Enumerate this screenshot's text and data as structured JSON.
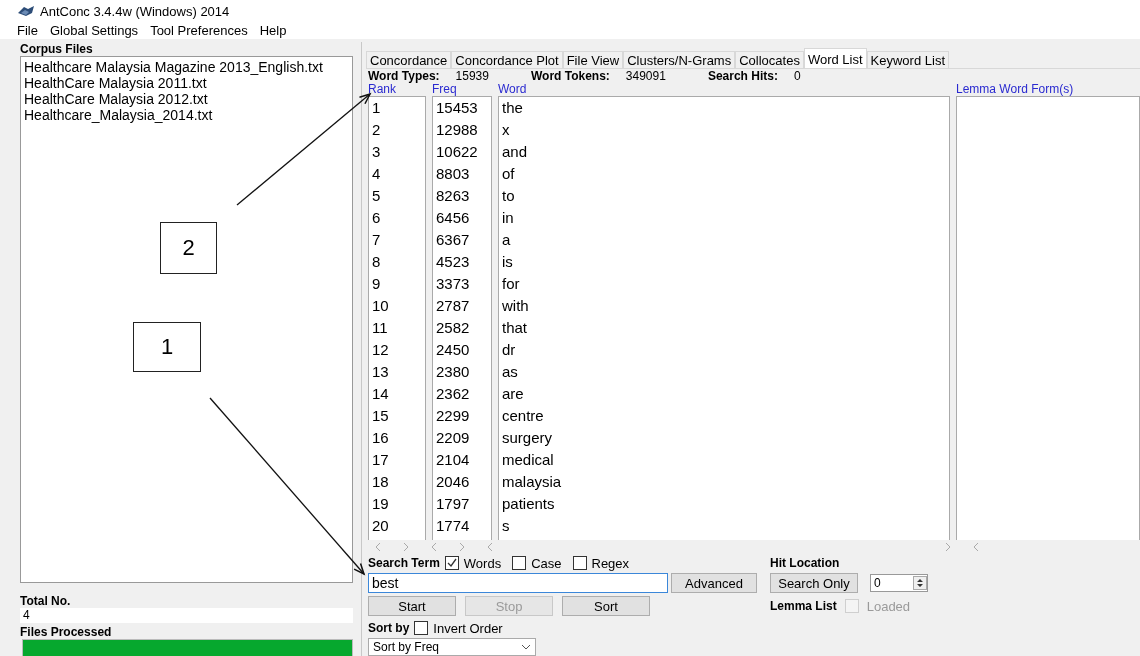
{
  "window": {
    "title": "AntConc 3.4.4w (Windows) 2014"
  },
  "menu": [
    "File",
    "Global Settings",
    "Tool Preferences",
    "Help"
  ],
  "corpus_files": {
    "label": "Corpus Files",
    "files": [
      "Healthcare Malaysia Magazine 2013_English.txt",
      "HealthCare Malaysia 2011.txt",
      "HealthCare Malaysia 2012.txt",
      "Healthcare_Malaysia_2014.txt"
    ]
  },
  "total": {
    "label": "Total No.",
    "value": "4"
  },
  "files_processed": {
    "label": "Files Processed",
    "level": 1
  },
  "tabs": [
    {
      "label": "Concordance",
      "selected": false
    },
    {
      "label": "Concordance Plot",
      "selected": false
    },
    {
      "label": "File View",
      "selected": false
    },
    {
      "label": "Clusters/N-Grams",
      "selected": false
    },
    {
      "label": "Collocates",
      "selected": false
    },
    {
      "label": "Word List",
      "selected": true
    },
    {
      "label": "Keyword List",
      "selected": false
    }
  ],
  "stats": [
    {
      "label": "Word Types:",
      "value": "15939"
    },
    {
      "label": "Word Tokens:",
      "value": "349091"
    },
    {
      "label": "Search Hits:",
      "value": "0"
    }
  ],
  "columns": [
    "Rank",
    "Freq",
    "Word"
  ],
  "rows": [
    {
      "rank": "1",
      "freq": "15453",
      "word": "the"
    },
    {
      "rank": "2",
      "freq": "12988",
      "word": "x"
    },
    {
      "rank": "3",
      "freq": "10622",
      "word": "and"
    },
    {
      "rank": "4",
      "freq": "8803",
      "word": "of"
    },
    {
      "rank": "5",
      "freq": "8263",
      "word": "to"
    },
    {
      "rank": "6",
      "freq": "6456",
      "word": "in"
    },
    {
      "rank": "7",
      "freq": "6367",
      "word": "a"
    },
    {
      "rank": "8",
      "freq": "4523",
      "word": "is"
    },
    {
      "rank": "9",
      "freq": "3373",
      "word": "for"
    },
    {
      "rank": "10",
      "freq": "2787",
      "word": "with"
    },
    {
      "rank": "11",
      "freq": "2582",
      "word": "that"
    },
    {
      "rank": "12",
      "freq": "2450",
      "word": "dr"
    },
    {
      "rank": "13",
      "freq": "2380",
      "word": "as"
    },
    {
      "rank": "14",
      "freq": "2362",
      "word": "are"
    },
    {
      "rank": "15",
      "freq": "2299",
      "word": "centre"
    },
    {
      "rank": "16",
      "freq": "2209",
      "word": "surgery"
    },
    {
      "rank": "17",
      "freq": "2104",
      "word": "medical"
    },
    {
      "rank": "18",
      "freq": "2046",
      "word": "malaysia"
    },
    {
      "rank": "19",
      "freq": "1797",
      "word": "patients"
    },
    {
      "rank": "20",
      "freq": "1774",
      "word": "s"
    }
  ],
  "lemma": {
    "label": "Lemma Word Form(s)"
  },
  "search": {
    "label": "Search Term",
    "options": [
      {
        "label": "Words",
        "checked": true
      },
      {
        "label": "Case",
        "checked": false
      },
      {
        "label": "Regex",
        "checked": false
      }
    ],
    "value": "best",
    "advanced": "Advanced"
  },
  "actions": [
    {
      "label": "Start",
      "disabled": false
    },
    {
      "label": "Stop",
      "disabled": true
    },
    {
      "label": "Sort",
      "disabled": false
    }
  ],
  "hit_location": {
    "label": "Hit Location",
    "button": "Search Only",
    "value": "0"
  },
  "lemma_list": {
    "label": "Lemma List",
    "option": {
      "label": "Loaded",
      "checked": false,
      "disabled": true
    }
  },
  "sort": {
    "label": "Sort by",
    "invert": {
      "label": "Invert Order",
      "checked": false
    },
    "value": "Sort by Freq"
  },
  "annotations": [
    {
      "label": "2"
    },
    {
      "label": "1"
    }
  ]
}
